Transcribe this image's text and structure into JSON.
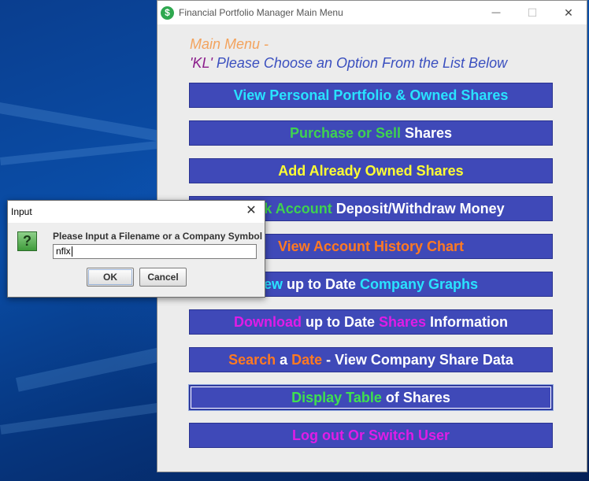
{
  "main_window": {
    "title": "Financial Portfolio Manager Main Menu",
    "icon_glyph": "$",
    "heading_line1": "Main Menu -",
    "heading_user": "'KL'",
    "heading_line2_rest": " Please Choose an Option From the List Below",
    "menu_buttons": [
      {
        "name": "view-portfolio-button",
        "parts": [
          {
            "text": "View Personal Portfolio & Owned Shares",
            "color": "#29e3ff"
          }
        ]
      },
      {
        "name": "purchase-sell-button",
        "parts": [
          {
            "text": "Purchase or Sell ",
            "color": "#3fd24f"
          },
          {
            "text": "Shares",
            "color": "#ffffff"
          }
        ]
      },
      {
        "name": "add-owned-shares-button",
        "parts": [
          {
            "text": "Add Already Owned Shares",
            "color": "#ffff33"
          }
        ]
      },
      {
        "name": "bank-account-button",
        "parts": [
          {
            "text": "Bank Account ",
            "color": "#3fd24f"
          },
          {
            "text": "Deposit/Withdraw Money",
            "color": "#ffffff"
          }
        ]
      },
      {
        "name": "account-history-chart-button",
        "parts": [
          {
            "text": "View Account History Chart",
            "color": "#ff7a22"
          }
        ]
      },
      {
        "name": "company-graphs-button",
        "parts": [
          {
            "text": "ew ",
            "color": "#29e3ff"
          },
          {
            "text": "up to Date ",
            "color": "#ffffff"
          },
          {
            "text": "Company Graphs",
            "color": "#29e3ff"
          }
        ]
      },
      {
        "name": "download-shares-button",
        "parts": [
          {
            "text": "Download ",
            "color": "#e01ce6"
          },
          {
            "text": "up to Date ",
            "color": "#ffffff"
          },
          {
            "text": "Shares ",
            "color": "#e01ce6"
          },
          {
            "text": "Information",
            "color": "#ffffff"
          }
        ]
      },
      {
        "name": "search-date-button",
        "parts": [
          {
            "text": "Search ",
            "color": "#ff7a22"
          },
          {
            "text": "a ",
            "color": "#ffffff"
          },
          {
            "text": "Date ",
            "color": "#ff7a22"
          },
          {
            "text": "- View Company Share Data",
            "color": "#ffffff"
          }
        ]
      },
      {
        "name": "display-table-button",
        "focused": true,
        "parts": [
          {
            "text": "Display Table ",
            "color": "#3fe04f"
          },
          {
            "text": "of Shares",
            "color": "#ffffff"
          }
        ]
      },
      {
        "name": "logout-switch-button",
        "parts": [
          {
            "text": "Log out Or Switch User",
            "color": "#e01ce6"
          }
        ]
      }
    ]
  },
  "dialog": {
    "title": "Input",
    "close_glyph": "✕",
    "icon_glyph": "?",
    "prompt": "Please Input a Filename or a Company Symbol",
    "input_value": "nflx",
    "ok_label": "OK",
    "cancel_label": "Cancel"
  },
  "window_controls": {
    "minimize": "—",
    "maximize": "☐",
    "close": "✕"
  }
}
